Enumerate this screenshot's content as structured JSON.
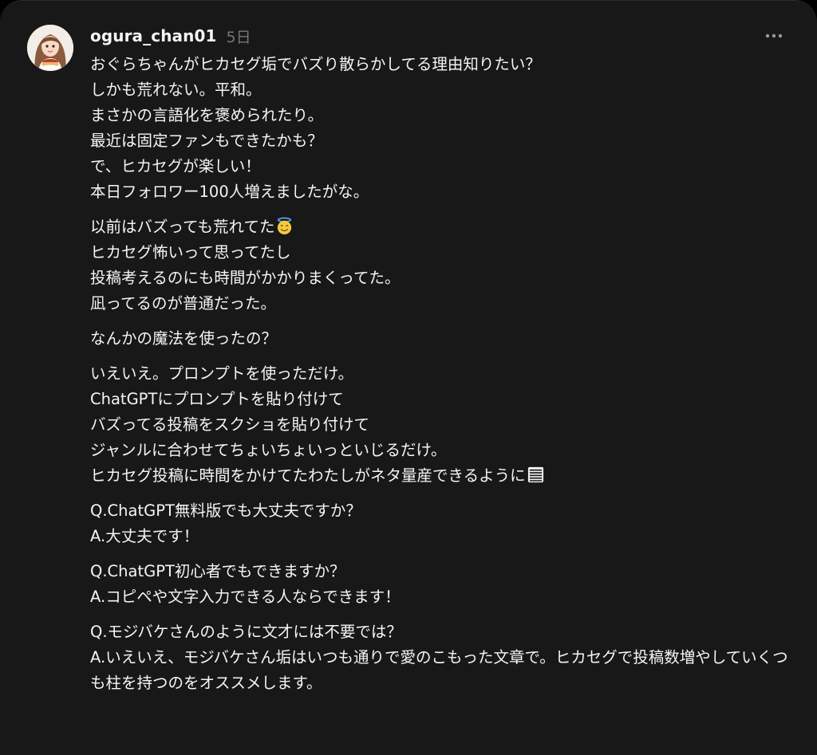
{
  "post": {
    "username": "ogura_chan01",
    "time": "5日",
    "more_icon": "ellipsis-icon",
    "avatar_icon": "avatar-photo"
  },
  "paragraphs": [
    {
      "lines": [
        "おぐらちゃんがヒカセグ垢でバズり散らかしてる理由知りたい？",
        "しかも荒れない。平和。",
        "まさかの言語化を褒められたり。",
        "最近は固定ファンもできたかも？",
        "で、ヒカセグが楽しい！",
        "本日フォロワー100人増えましたがな。"
      ]
    },
    {
      "lines": [
        "以前はバズっても荒れてた",
        "ヒカセグ怖いって思ってたし",
        "投稿考えるのにも時間がかかりまくってた。",
        "凪ってるのが普通だった。"
      ]
    },
    {
      "lines": [
        "なんかの魔法を使ったの？"
      ]
    },
    {
      "lines": [
        "いえいえ。プロンプトを使っただけ。",
        "ChatGPTにプロンプトを貼り付けて",
        "バズってる投稿をスクショを貼り付けて",
        "ジャンルに合わせてちょいちょいっといじるだけ。",
        "ヒカセグ投稿に時間をかけてたわたしがネタ量産できるように"
      ]
    },
    {
      "lines": [
        "Q.ChatGPT無料版でも大丈夫ですか？",
        "A.大丈夫です！"
      ]
    },
    {
      "lines": [
        "Q.ChatGPT初心者でもできますか？",
        "A.コピペや文字入力できる人ならできます！"
      ]
    },
    {
      "lines": [
        "Q.モジバケさんのように文才には不要では？",
        "A.いえいえ、モジバケさん垢はいつも通りで愛のこもった文章で。ヒカセグで投稿数増やしていくつも柱を持つのをオススメします。"
      ]
    }
  ],
  "emojis": {
    "halo": "smiling-face-with-halo-icon",
    "memo": "pencil-memo-icon"
  },
  "colors": {
    "background": "#181818",
    "text": "#f3f5f7",
    "secondary": "#777777"
  }
}
